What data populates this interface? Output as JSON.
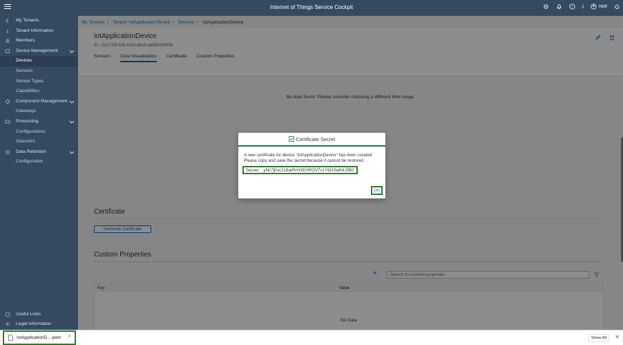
{
  "shell": {
    "title": "Internet of Things Service Cockpit",
    "user": "root"
  },
  "sidebar": {
    "items": [
      {
        "label": "My Tenants"
      },
      {
        "label": "Tenant Information"
      },
      {
        "label": "Members"
      },
      {
        "label": "Device Management"
      },
      {
        "label": "Devices"
      },
      {
        "label": "Sensors"
      },
      {
        "label": "Sensor Types"
      },
      {
        "label": "Capabilities"
      },
      {
        "label": "Component Management"
      },
      {
        "label": "Gateways"
      },
      {
        "label": "Processing"
      },
      {
        "label": "Configurations"
      },
      {
        "label": "Selectors"
      },
      {
        "label": "Data Retention"
      },
      {
        "label": "Configuration"
      }
    ],
    "bottom": [
      {
        "label": "Useful Links"
      },
      {
        "label": "Legal Information"
      }
    ]
  },
  "breadcrumb": {
    "c1": "My Tenants",
    "c2": "Tenant: IotApplicationTenant",
    "c3": "Devices",
    "current": "IotApplicationDevice"
  },
  "object": {
    "title": "IotApplicationDevice",
    "id": "ID: c3c1719f-fcfd-40d0-bbc6-aeb60cf96f06"
  },
  "tabs": [
    "Sensors",
    "Data Visualization",
    "Certificate",
    "Custom Properties"
  ],
  "content": {
    "no_data_viz": "No data found. Please consider choosing a different time range.",
    "certificate_title": "Certificate",
    "generate_button": "Generate Certificate",
    "custom_props_title": "Custom Properties",
    "search_placeholder": "Search for custom properties",
    "col_key": "Key",
    "col_value": "Value",
    "table_no_data": "No Data"
  },
  "dialog": {
    "title": "Certificate Secret",
    "message": "A new certificate for device \"IotApplicationDevice\" has been created. Please copy and save the secret because it cannot be restored.",
    "secret_label": "Secret:",
    "secret_value": "yNc7jKxc218arRrHXEHROV7v1Y6OSwlNU5B0",
    "ok": "OK"
  },
  "downloads": {
    "file": "IotApplicationD....pem",
    "show_all": "Show All"
  },
  "colors": {
    "shell": "#354a5f",
    "accent": "#0a6ed1",
    "success": "#107e3e"
  }
}
